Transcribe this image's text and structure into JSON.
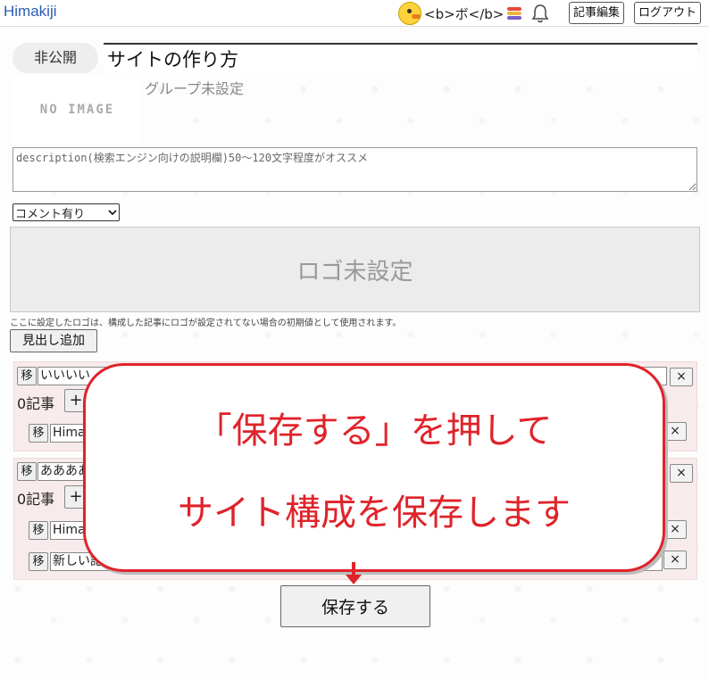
{
  "header": {
    "brand": "Himakiji",
    "username": "<b>ボ</b>",
    "edit_button": "記事編集",
    "logout_button": "ログアウト",
    "stack_colors": [
      "#e8493c",
      "#f0b63c",
      "#7a5ec8"
    ]
  },
  "editor": {
    "visibility": "非公開",
    "title_value": "サイトの作り方",
    "no_image": "NO IMAGE",
    "group": "グループ未設定",
    "description_placeholder": "description(検索エンジン向けの説明欄)50～120文字程度がオススメ",
    "comment_option": "コメント有り",
    "logo_placeholder": "ロゴ未設定",
    "logo_note": "ここに設定したロゴは、構成した記事にロゴが設定されてない場合の初期値として使用されます。",
    "add_heading_button": "見出し追加",
    "move_label": "移",
    "remove_label": "×",
    "plus_label": "+"
  },
  "sections": [
    {
      "heading": "いいいい",
      "count": "0記事",
      "articles": [
        "Hima"
      ]
    },
    {
      "heading": "ああああ",
      "count": "0記事",
      "articles": [
        "Hima",
        "新しい記事1"
      ]
    }
  ],
  "callout": {
    "line1": "「保存する」を押して",
    "line2": "サイト構成を保存します"
  },
  "save_button": "保存する"
}
